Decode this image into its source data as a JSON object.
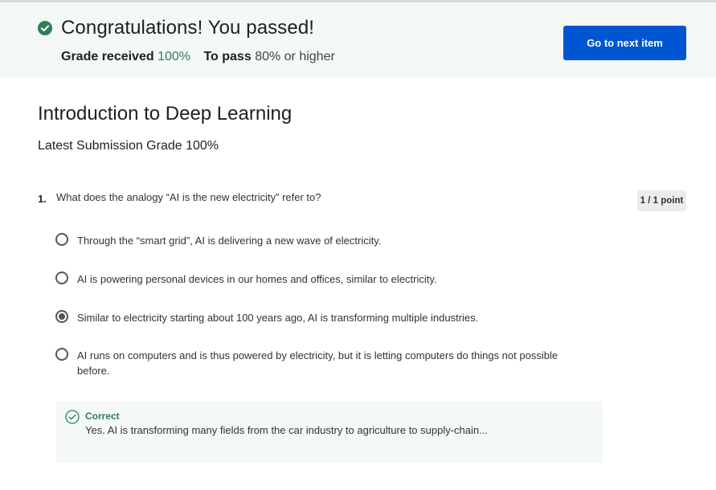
{
  "banner": {
    "title": "Congratulations! You passed!",
    "grade_label": "Grade received",
    "grade_value": "100%",
    "pass_label": "To pass",
    "pass_value": "80% or higher",
    "next_button": "Go to next item"
  },
  "quiz": {
    "title": "Introduction to Deep Learning",
    "latest_grade_label": "Latest Submission Grade",
    "latest_grade_value": "100%"
  },
  "question": {
    "number": "1.",
    "text": "What does the analogy “AI is the new electricity” refer to?",
    "points": "1 / 1 point",
    "options": [
      {
        "text": "Through the “smart grid”, AI is delivering a new wave of electricity.",
        "selected": false
      },
      {
        "text": "AI is powering personal devices in our homes and offices, similar to electricity.",
        "selected": false
      },
      {
        "text": "Similar to electricity starting about 100 years ago, AI is transforming multiple industries.",
        "selected": true
      },
      {
        "text": "AI runs on computers and is thus powered by electricity, but it is letting computers do things not possible before.",
        "selected": false
      }
    ],
    "feedback": {
      "label": "Correct",
      "text": "Yes. AI is transforming many fields from the car industry to agriculture to supply-chain..."
    }
  },
  "colors": {
    "accent": "#0056d2",
    "success": "#2f7e55",
    "banner_bg": "#f4f8f7"
  },
  "icons": {
    "banner_check": "check-circle-filled-icon",
    "feedback_check": "check-circle-outline-icon"
  }
}
